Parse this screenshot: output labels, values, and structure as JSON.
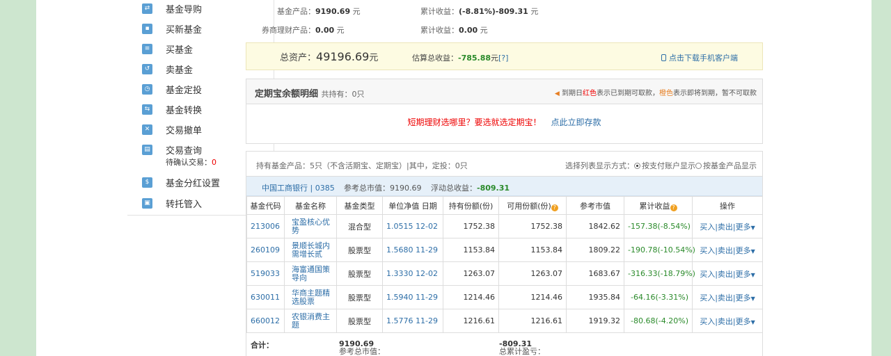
{
  "sidebar": {
    "items": [
      {
        "label": "基金导购",
        "icon": "fund-guide-icon"
      },
      {
        "label": "买新基金",
        "icon": "new-fund-icon"
      },
      {
        "label": "买基金",
        "icon": "buy-fund-icon"
      },
      {
        "label": "卖基金",
        "icon": "sell-fund-icon"
      },
      {
        "label": "基金定投",
        "icon": "auto-invest-icon"
      },
      {
        "label": "基金转换",
        "icon": "fund-switch-icon"
      },
      {
        "label": "交易撤单",
        "icon": "cancel-order-icon"
      },
      {
        "label": "交易查询",
        "icon": "trade-query-icon"
      },
      {
        "label": "基金分红设置",
        "icon": "dividend-setting-icon"
      },
      {
        "label": "转托管入",
        "icon": "transfer-in-icon"
      }
    ],
    "pending_label": "待确认交易：",
    "pending_count": "0"
  },
  "summary": {
    "fund_label": "基金产品：",
    "fund_value": "9190.69",
    "fund_unit": "元",
    "fund_cum_label": "累计收益：",
    "fund_cum_pct": "(-8.81%)",
    "fund_cum_value": "-809.31",
    "fund_cum_unit": "元",
    "broker_label": "券商理财产品：",
    "broker_value": "0.00",
    "broker_unit": "元",
    "broker_cum_label": "累计收益：",
    "broker_cum_value": "0.00",
    "broker_cum_unit": "元"
  },
  "total": {
    "label": "总资产：",
    "value": "49196.69",
    "unit": "元",
    "est_label": "估算总收益：",
    "est_value": "-785.88",
    "est_unit": "元",
    "help": "[?]",
    "download": "点击下载手机客户端"
  },
  "dingqi": {
    "title": "定期宝余额明细",
    "held_label": "共持有：",
    "held_value": "0只",
    "note_a": "到期日",
    "note_red": "红色",
    "note_b": "表示已到期可取款，",
    "note_orange": "橙色",
    "note_c": "表示即将到期，暂不可取款",
    "promo_text": "短期理财选哪里？要选就选定期宝！",
    "promo_link": "点此立即存款"
  },
  "holdings": {
    "info": "持有基金产品：",
    "info_count": "5只",
    "info_rest": "（不含活期宝、定期宝）|其中，定投：",
    "info_dt": "0只",
    "view_label": "选择列表显示方式：",
    "view_opt1": "按支付账户显示",
    "view_opt2": "按基金产品显示",
    "account": "中国工商银行 | 0385",
    "mkt_label": "参考总市值：",
    "mkt_value": "9190.69",
    "float_label": "浮动总收益：",
    "float_value": "-809.31",
    "columns": [
      "基金代码",
      "基金名称",
      "基金类型",
      "单位净值 日期",
      "持有份额(份)",
      "可用份额(份)",
      "参考市值",
      "累计收益",
      "操作"
    ],
    "rows": [
      {
        "code": "213006",
        "name": "宝盈核心优势",
        "type": "混合型",
        "nav": "1.0515",
        "date": "12-02",
        "held": "1752.38",
        "avail": "1752.38",
        "mkt": "1842.62",
        "gain": "-157.38(-8.54%)"
      },
      {
        "code": "260109",
        "name": "景顺长城内需增长贰",
        "type": "股票型",
        "nav": "1.5680",
        "date": "11-29",
        "held": "1153.84",
        "avail": "1153.84",
        "mkt": "1809.22",
        "gain": "-190.78(-10.54%)"
      },
      {
        "code": "519033",
        "name": "海富通国策导向",
        "type": "股票型",
        "nav": "1.3330",
        "date": "12-02",
        "held": "1263.07",
        "avail": "1263.07",
        "mkt": "1683.67",
        "gain": "-316.33(-18.79%)"
      },
      {
        "code": "630011",
        "name": "华商主题精选股票",
        "type": "股票型",
        "nav": "1.5940",
        "date": "11-29",
        "held": "1214.46",
        "avail": "1214.46",
        "mkt": "1935.84",
        "gain": "-64.16(-3.31%)"
      },
      {
        "code": "660012",
        "name": "农银消费主题",
        "type": "股票型",
        "nav": "1.5776",
        "date": "11-29",
        "held": "1216.61",
        "avail": "1216.61",
        "mkt": "1919.32",
        "gain": "-80.68(-4.20%)"
      }
    ],
    "ops": {
      "buy": "买入",
      "sell": "卖出",
      "more": "更多"
    },
    "footer": {
      "total_label": "合计：",
      "mkt_label": "参考总市值：",
      "mkt_value": "9190.69",
      "cum_label": "总累计盈亏：",
      "cum_value": "-809.31"
    }
  },
  "colors": {
    "background": "#cde6cf",
    "link": "#2d6ea7",
    "negative": "#2a8a2a",
    "alert": "#e00000"
  }
}
